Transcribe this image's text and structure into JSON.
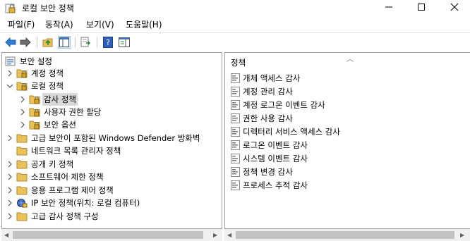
{
  "window": {
    "title": "로컬 보안 정책"
  },
  "menu": [
    "파일(F)",
    "동작(A)",
    "보기(V)",
    "도움말(H)"
  ],
  "toolbar": {
    "icons": [
      "back-arrow-icon",
      "forward-arrow-icon",
      "up-folder-icon",
      "show-hide-tree-icon",
      "export-list-icon",
      "help-icon",
      "properties-pane-icon"
    ]
  },
  "tree": {
    "root": "보안 설정",
    "items": [
      {
        "label": "계정 정책"
      },
      {
        "label": "로컬 정책"
      },
      {
        "label": "감사 정책"
      },
      {
        "label": "사용자 권한 할당"
      },
      {
        "label": "보안 옵션"
      },
      {
        "label": "고급 보안이 포함된 Windows Defender 방화벽"
      },
      {
        "label": "네트워크 목록 관리자 정책"
      },
      {
        "label": "공개 키 정책"
      },
      {
        "label": "소프트웨어 제한 정책"
      },
      {
        "label": "응용 프로그램 제어 정책"
      },
      {
        "label": "IP 보안 정책(위치: 로컬 컴퓨터)"
      },
      {
        "label": "고급 감사 정책 구성"
      }
    ]
  },
  "list": {
    "header": "정책",
    "items": [
      "개체 액세스 감사",
      "계정 관리 감사",
      "계정 로그온 이벤트 감사",
      "권한 사용 감사",
      "디렉터리 서비스 액세스 감사",
      "로그온 이벤트 감사",
      "시스템 이벤트 감사",
      "정책 변경 감사",
      "프로세스 추적 감사"
    ]
  },
  "colors": {
    "folder": "#e8c15a",
    "selection": "#d9d9d9",
    "accent": "#1c6fd1"
  }
}
